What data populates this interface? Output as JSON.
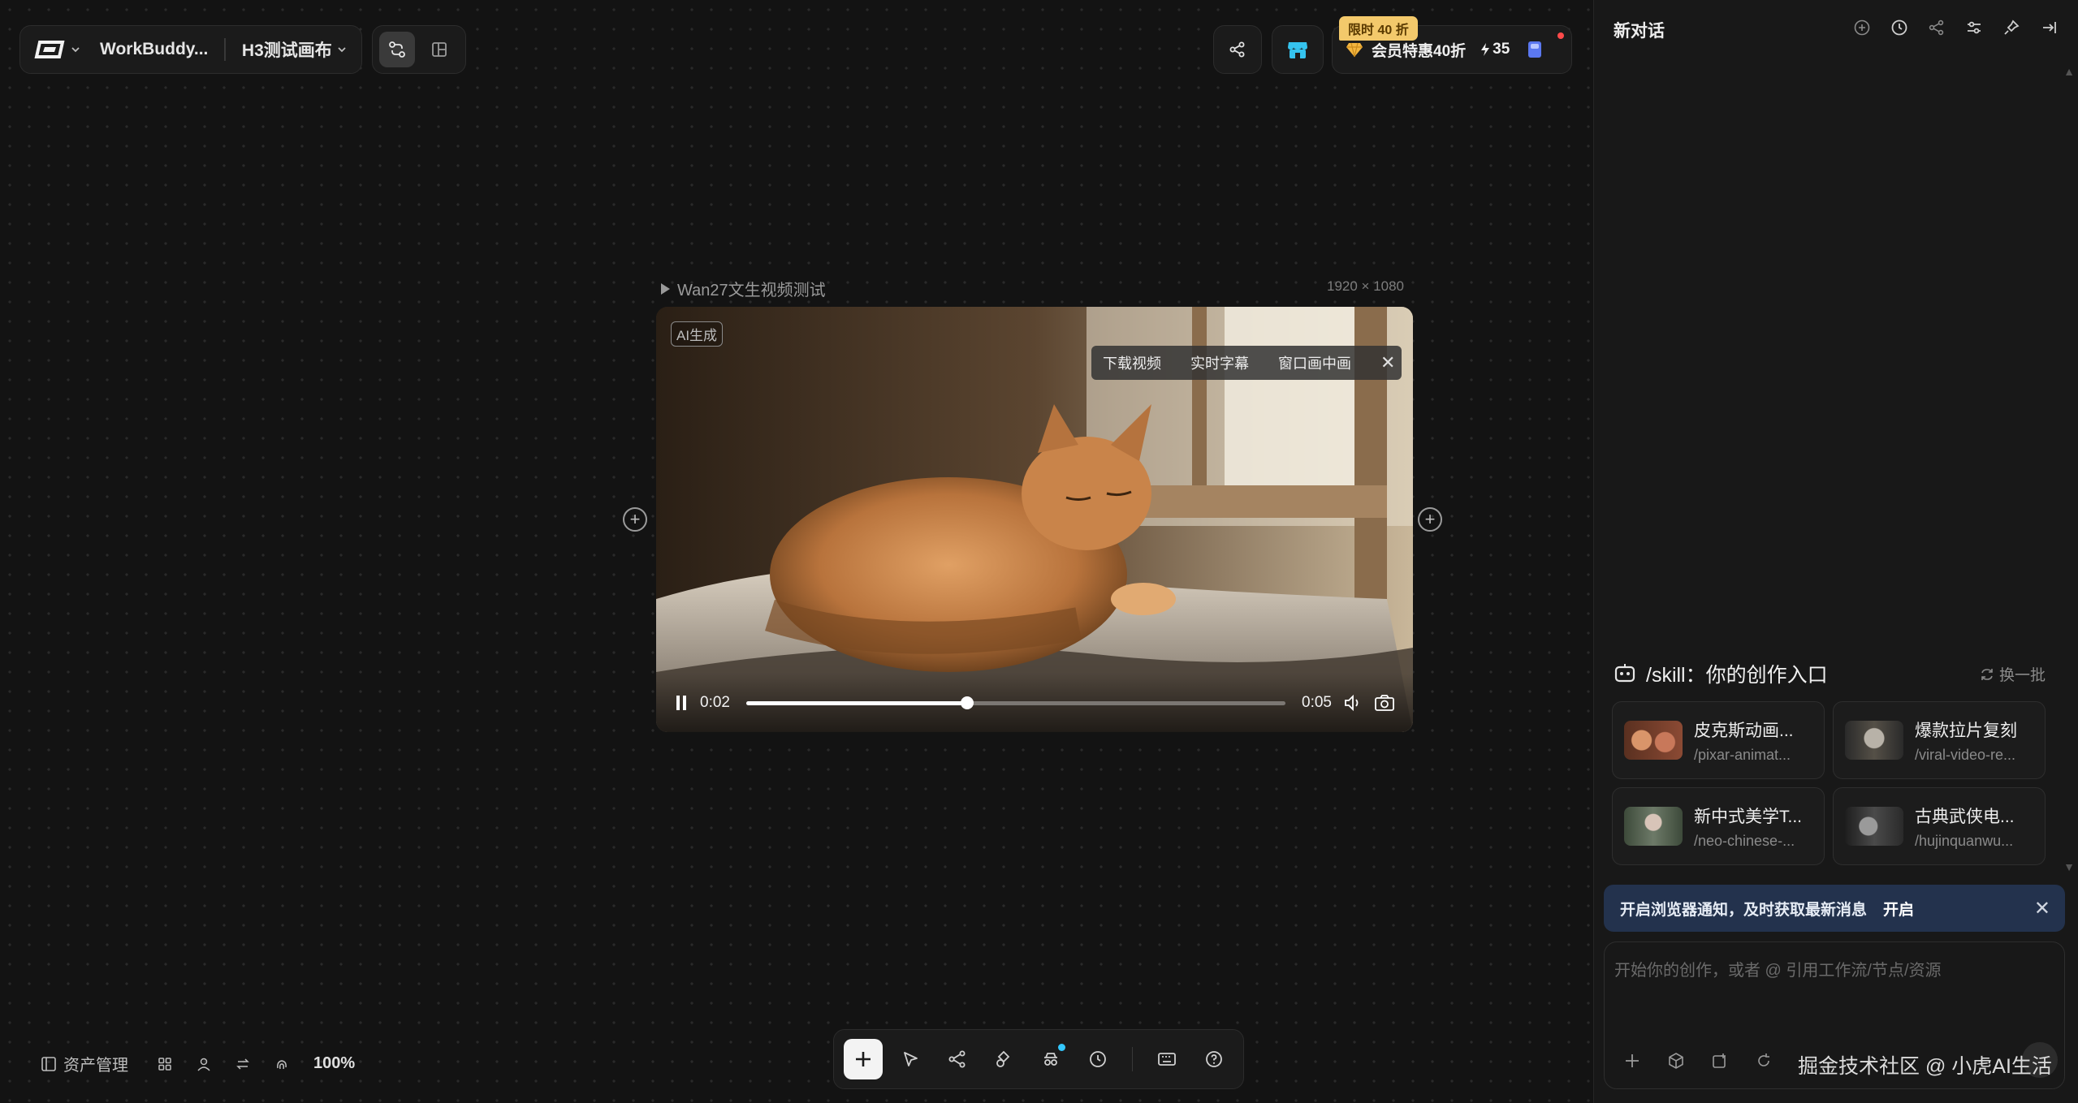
{
  "topbar": {
    "logo_icon": "workbuddy-logo-icon",
    "project_name": "WorkBuddy...",
    "canvas_name": "H3测试画布",
    "mode_icons": [
      "flow-mode-icon",
      "layout-mode-icon"
    ],
    "share_icon": "share-icon",
    "store_icon": "store-icon",
    "promo_badge": "限时 40 折",
    "member_label": "会员特惠40折",
    "credits": "35",
    "user_icon": "user-badge-icon"
  },
  "node": {
    "title": "Wan27文生视频测试",
    "resolution": "1920 × 1080",
    "ai_tag": "AI生成",
    "menu": [
      "下载视频",
      "实时字幕",
      "窗口画中画"
    ],
    "menu_close": "✕",
    "current_time": "0:02",
    "duration": "0:05",
    "progress": 0.41
  },
  "bottom_left": {
    "assets_label": "资产管理",
    "zoom": "100%"
  },
  "toolbar": {
    "tools": [
      "add-icon",
      "select-icon",
      "workflow-icon",
      "shapes-icon",
      "agent-icon",
      "history-icon",
      "keyboard-icon",
      "help-icon"
    ]
  },
  "panel": {
    "title": "新对话",
    "header_icons": [
      "new-chat-icon",
      "history-icon",
      "share-icon",
      "settings-icon",
      "pin-icon",
      "collapse-icon"
    ],
    "skill_heading": "/skill：你的创作入口",
    "swap_label": "换一批",
    "skills": [
      {
        "title": "皮克斯动画...",
        "slug": "/pixar-animat..."
      },
      {
        "title": "爆款拉片复刻",
        "slug": "/viral-video-re..."
      },
      {
        "title": "新中式美学T...",
        "slug": "/neo-chinese-..."
      },
      {
        "title": "古典武侠电...",
        "slug": "/hujinquanwu..."
      }
    ],
    "notify_text": "开启浏览器通知，及时获取最新消息",
    "notify_link": "开启",
    "composer_placeholder": "开始你的创作，或者 @ 引用工作流/节点/资源",
    "watermark": "掘金技术社区 @ 小虎AI生活"
  },
  "colors": {
    "canvas_bg": "#131313",
    "panel_bg": "#181818",
    "promo": "#f3c96b",
    "notify_bg": "#23324d",
    "store_accent": "#35c3ee"
  }
}
